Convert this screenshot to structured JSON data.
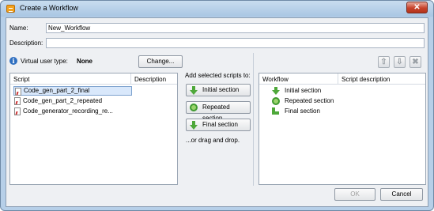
{
  "window": {
    "title": "Create a Workflow",
    "close_glyph": "✕"
  },
  "form": {
    "name_label": "Name:",
    "name_value": "New_Workflow",
    "description_label": "Description:",
    "description_value": "",
    "vuser_label": "Virtual user type:",
    "vuser_value": "None",
    "change_button": "Change..."
  },
  "scripts_panel": {
    "columns": [
      "Script",
      "Description"
    ],
    "rows": [
      {
        "name": "Code_gen_part_2_final",
        "selected": true
      },
      {
        "name": "Code_gen_part_2_repeated",
        "selected": false
      },
      {
        "name": "Code_generator_recording_re...",
        "selected": false
      }
    ]
  },
  "middle": {
    "add_label": "Add selected scripts to:",
    "initial_button": "Initial section",
    "repeated_button": "Repeated section",
    "final_button": "Final section",
    "drag_hint": "...or drag and drop."
  },
  "workflow_panel": {
    "columns": [
      "Workflow",
      "Script description"
    ],
    "rows": [
      {
        "name": "Initial section",
        "icon": "down-arrow-icon"
      },
      {
        "name": "Repeated section",
        "icon": "cycle-icon"
      },
      {
        "name": "Final section",
        "icon": "final-arrow-icon"
      }
    ]
  },
  "toolbar": {
    "move_up": "⇧",
    "move_down": "⇩",
    "remove": "✖"
  },
  "footer": {
    "ok_button": "OK",
    "cancel_button": "Cancel"
  }
}
